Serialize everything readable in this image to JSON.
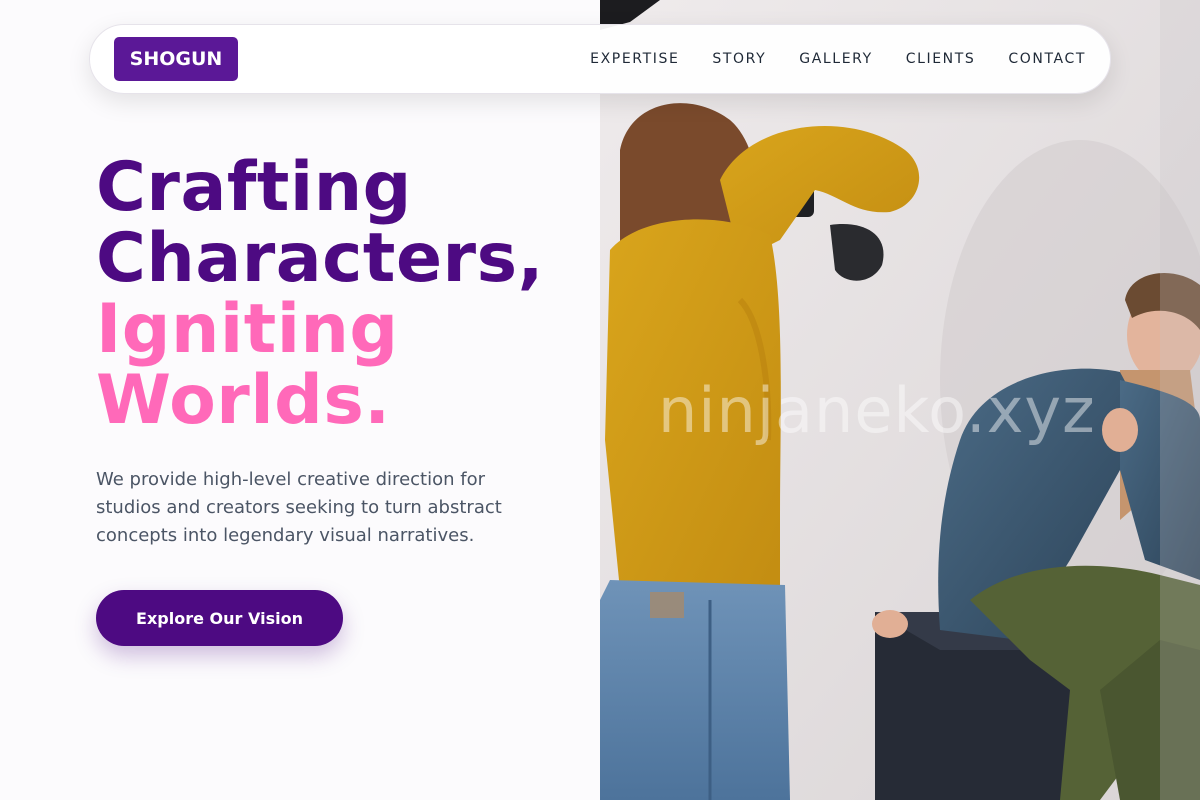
{
  "brand": {
    "name": "SHOGUN"
  },
  "nav": {
    "items": [
      {
        "label": "EXPERTISE"
      },
      {
        "label": "STORY"
      },
      {
        "label": "GALLERY"
      },
      {
        "label": "CLIENTS"
      },
      {
        "label": "CONTACT"
      }
    ]
  },
  "hero": {
    "headline_lines": [
      {
        "text": "Crafting",
        "color": "#4d0a82"
      },
      {
        "text": "Characters,",
        "color": "#4d0a82"
      },
      {
        "text": "Igniting",
        "color": "#ff69b9"
      },
      {
        "text": "Worlds.",
        "color": "#ff69b9"
      }
    ],
    "subtext": "We provide high-level creative direction for studios and creators seeking to turn abstract concepts into legendary visual narratives.",
    "cta_label": "Explore Our Vision"
  },
  "photo": {
    "watermark": "ninjaneko.xyz"
  },
  "colors": {
    "primary": "#4d0a82",
    "accent": "#ff69b9",
    "logo_bg": "#5b1897"
  }
}
